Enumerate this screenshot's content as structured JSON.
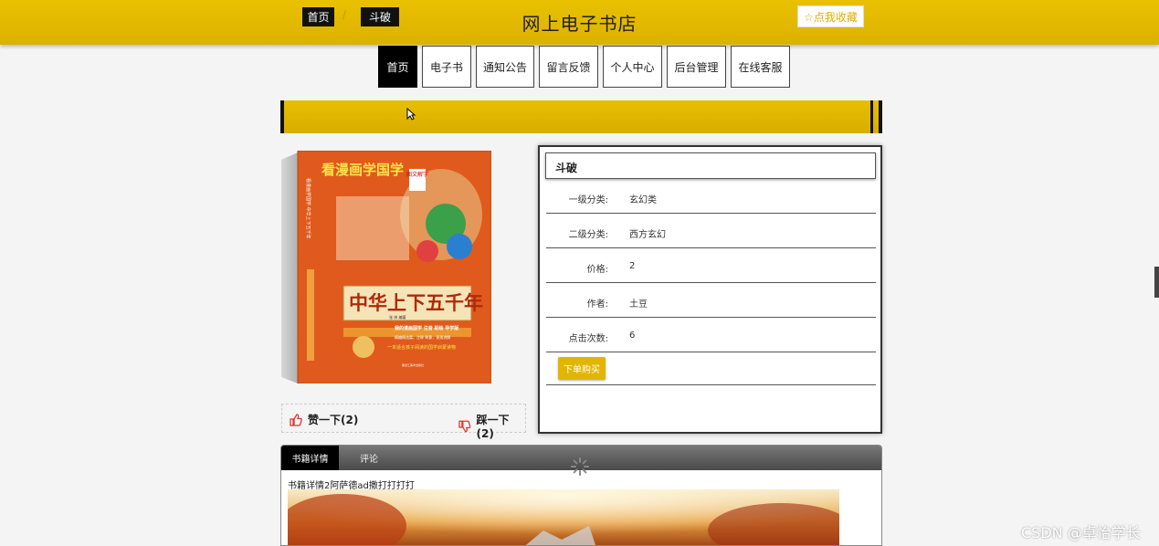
{
  "header": {
    "title": "网上电子书店"
  },
  "nav": {
    "items": [
      {
        "label": "首页",
        "active": true
      },
      {
        "label": "电子书"
      },
      {
        "label": "通知公告"
      },
      {
        "label": "留言反馈"
      },
      {
        "label": "个人中心"
      },
      {
        "label": "后台管理"
      },
      {
        "label": "在线客服"
      }
    ]
  },
  "breadcrumb": {
    "home": "首页",
    "separator": "/",
    "current": "斗破",
    "favorite": "☆点我收藏"
  },
  "cover": {
    "top_title": "看漫画学国学",
    "badge": "图文解字",
    "spine_text": "看漫画学国学·中华上下五千年",
    "main_title": "中华上下五千年",
    "author_line": "张 帅 编著",
    "slogan1": "我的漫画国学 注音 彩绘 导学版",
    "slogan2": "精编精选篇，注释 释意，直观讲解",
    "slogan3": "一本适合孩子阅读的国学启蒙读物",
    "publisher": "黑龙江美术出版社"
  },
  "votes": {
    "like": "赞一下(2)",
    "dislike": "踩一下(2)"
  },
  "info": {
    "title": "斗破",
    "rows": [
      {
        "label": "一级分类:",
        "value": "玄幻类"
      },
      {
        "label": "二级分类:",
        "value": "西方玄幻"
      },
      {
        "label": "价格:",
        "value": "2"
      },
      {
        "label": "作者:",
        "value": "土豆"
      },
      {
        "label": "点击次数:",
        "value": "6"
      }
    ],
    "buy": "下单购买"
  },
  "tabs": {
    "detail": "书籍详情",
    "comments": "评论",
    "detail_text": "书籍详情2阿萨德ad撒打打打打"
  },
  "watermark": "CSDN @卓怡学长",
  "colors": {
    "accent": "#e2b500",
    "header": "#e9c100",
    "active_nav": "#000000"
  }
}
